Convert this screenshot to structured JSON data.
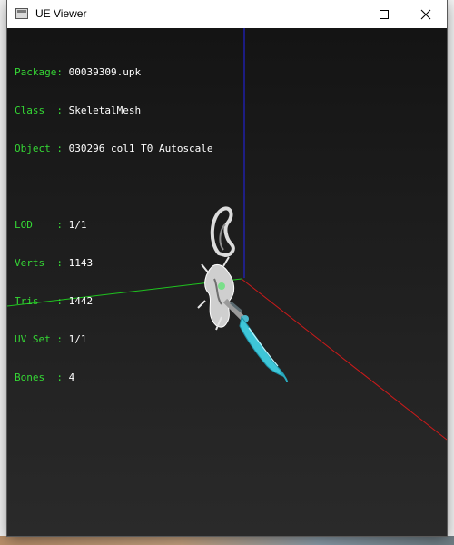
{
  "window": {
    "title": "UE Viewer"
  },
  "info": {
    "package": {
      "key": "Package",
      "sep": ": ",
      "value": "00039309.upk"
    },
    "class": {
      "key": "Class  ",
      "sep": ": ",
      "value": "SkeletalMesh"
    },
    "object": {
      "key": "Object ",
      "sep": ": ",
      "value": "030296_col1_T0_Autoscale"
    },
    "lod": {
      "key": "LOD    ",
      "sep": ": ",
      "value": "1/1"
    },
    "verts": {
      "key": "Verts  ",
      "sep": ": ",
      "value": "1143"
    },
    "tris": {
      "key": "Tris   ",
      "sep": ": ",
      "value": "1442"
    },
    "uvset": {
      "key": "UV Set ",
      "sep": ": ",
      "value": "1/1"
    },
    "bones": {
      "key": "Bones  ",
      "sep": ": ",
      "value": "4"
    }
  },
  "colors": {
    "label_green": "#35d835",
    "axis_x": "#cc1a1a",
    "axis_y": "#1fc41f",
    "axis_z": "#2222ee",
    "blade_cyan": "#3ec6d8"
  },
  "icons": {
    "app": "window-icon",
    "minimize": "minimize-icon",
    "maximize": "maximize-icon",
    "close": "close-icon"
  }
}
